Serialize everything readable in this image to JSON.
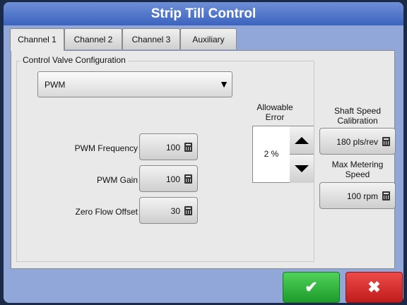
{
  "window": {
    "title": "Strip Till Control"
  },
  "tabs": [
    {
      "label": "Channel 1",
      "active": true
    },
    {
      "label": "Channel 2",
      "active": false
    },
    {
      "label": "Channel 3",
      "active": false
    },
    {
      "label": "Auxiliary",
      "active": false
    }
  ],
  "valve_config": {
    "group_title": "Control Valve Configuration",
    "selected": "PWM",
    "dropdown_arrow": "▼"
  },
  "fields": {
    "pwm_frequency": {
      "label": "PWM Frequency",
      "value": "100"
    },
    "pwm_gain": {
      "label": "PWM Gain",
      "value": "100"
    },
    "zero_flow_offset": {
      "label": "Zero Flow Offset",
      "value": "30"
    }
  },
  "allowable_error": {
    "label_line1": "Allowable",
    "label_line2": "Error",
    "value": "2 %"
  },
  "shaft_speed": {
    "label_line1": "Shaft Speed",
    "label_line2": "Calibration",
    "value": "180 pls/rev"
  },
  "max_metering": {
    "label_line1": "Max Metering",
    "label_line2": "Speed",
    "value": "100 rpm"
  },
  "actions": {
    "ok_glyph": "✔",
    "cancel_glyph": "✖"
  },
  "icons": {
    "calculator": "calculator-icon",
    "up": "arrow-up-icon",
    "down": "arrow-down-icon"
  },
  "colors": {
    "title_bar": "#3b63bf",
    "frame_bg": "#91a7d9",
    "ok": "#2bb137",
    "cancel": "#d22a2a"
  }
}
